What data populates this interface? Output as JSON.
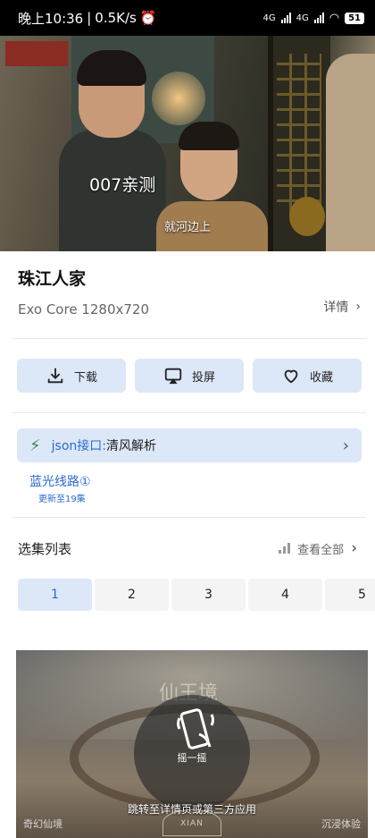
{
  "status_bar": {
    "time": "晚上10:36",
    "speed": "0.5K/s",
    "network1": "4G",
    "network2": "4G",
    "battery": "51"
  },
  "video": {
    "watermark": "007亲测",
    "subtitle": "就河边上"
  },
  "info": {
    "title": "珠江人家",
    "meta": "Exo Core  1280x720",
    "details_label": "详情"
  },
  "actions": {
    "download": "下载",
    "cast": "投屏",
    "favorite": "收藏"
  },
  "json_api": {
    "label": "json接口:",
    "value": "清风解析"
  },
  "route": {
    "name": "蓝光线路①",
    "update": "更新至19集"
  },
  "episodes": {
    "header": "选集列表",
    "view_all": "查看全部",
    "items": [
      "1",
      "2",
      "3",
      "4",
      "5"
    ],
    "selected": "1"
  },
  "ad": {
    "title": "仙王境",
    "shake_label": "摇一摇",
    "jump_text": "跳转至详情页或第三方应用",
    "corner_left": "奇幻仙境",
    "corner_right": "沉浸体验",
    "seal": "XIAN"
  },
  "colors": {
    "accent": "#2a6bd0",
    "button_bg": "#dce8f8"
  }
}
